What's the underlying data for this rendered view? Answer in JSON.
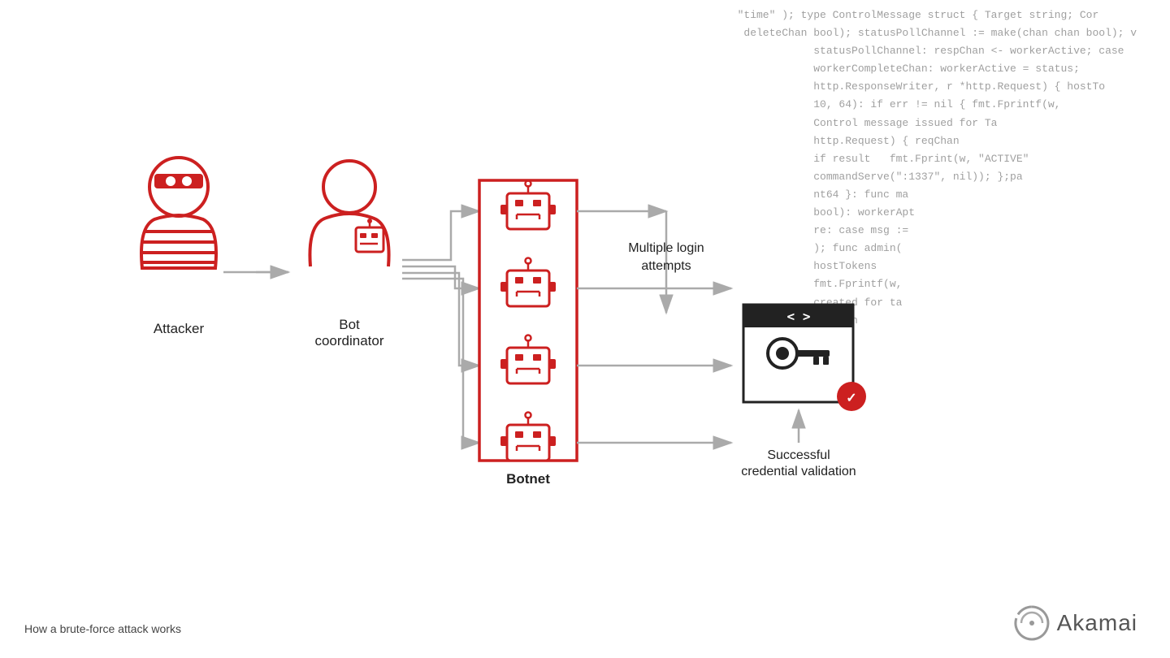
{
  "code_bg": {
    "lines": [
      "\"time\" ); type ControlMessage struct { Target string; Co",
      "deleteChan bool); statusPollChannel := make(chan chan bool); v",
      "          statusPollChannel: respChan <- workerActive; case",
      "          workerCompleteChan: workerActive = status;",
      "          http.ResponseWriter, r *http.Request) { hostTo",
      "          10, 64): if err != nil { fmt.Fprintf(w,",
      "          Control message issued for Ta",
      "          http.Request) { reqChan",
      "          if result   fmt.Fprint(w, \"ACTIVE\"",
      "          commandServe(\":1337\", nil)); };pa",
      "          nt64 }: func ma",
      "          bool): workerAct",
      "          re: case msg :=",
      "          ); func admin(",
      "          hostTokens",
      "          fmt.Fprintf(w,",
      "          created for ta",
      "          reqchan",
      ""
    ]
  },
  "diagram": {
    "attacker_label": "Attacker",
    "bot_coord_label": "Bot\ncoordinator",
    "botnet_label": "Botnet",
    "login_label": "Multiple login\nattempts",
    "cred_label": "Successful\ncredential validation"
  },
  "footer": {
    "caption": "How a brute-force attack works",
    "logo_text": "Akamai"
  },
  "colors": {
    "red": "#cc2020",
    "arrow": "#aaa",
    "text": "#222"
  }
}
